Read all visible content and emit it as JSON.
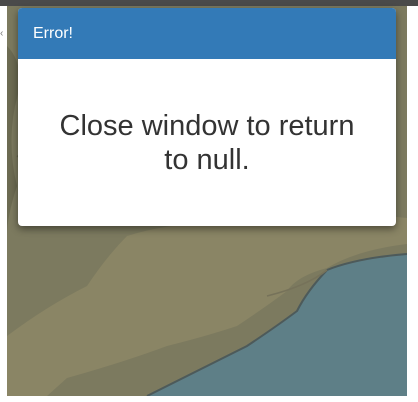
{
  "dialog": {
    "title": "Error!",
    "message": "Close window to return to null."
  },
  "colors": {
    "header_bg": "#337ab7",
    "overlay_land": "#7c7a5f",
    "overlay_water": "#5e7f87"
  },
  "icons": {
    "left_edge": "chevron-left-icon"
  }
}
